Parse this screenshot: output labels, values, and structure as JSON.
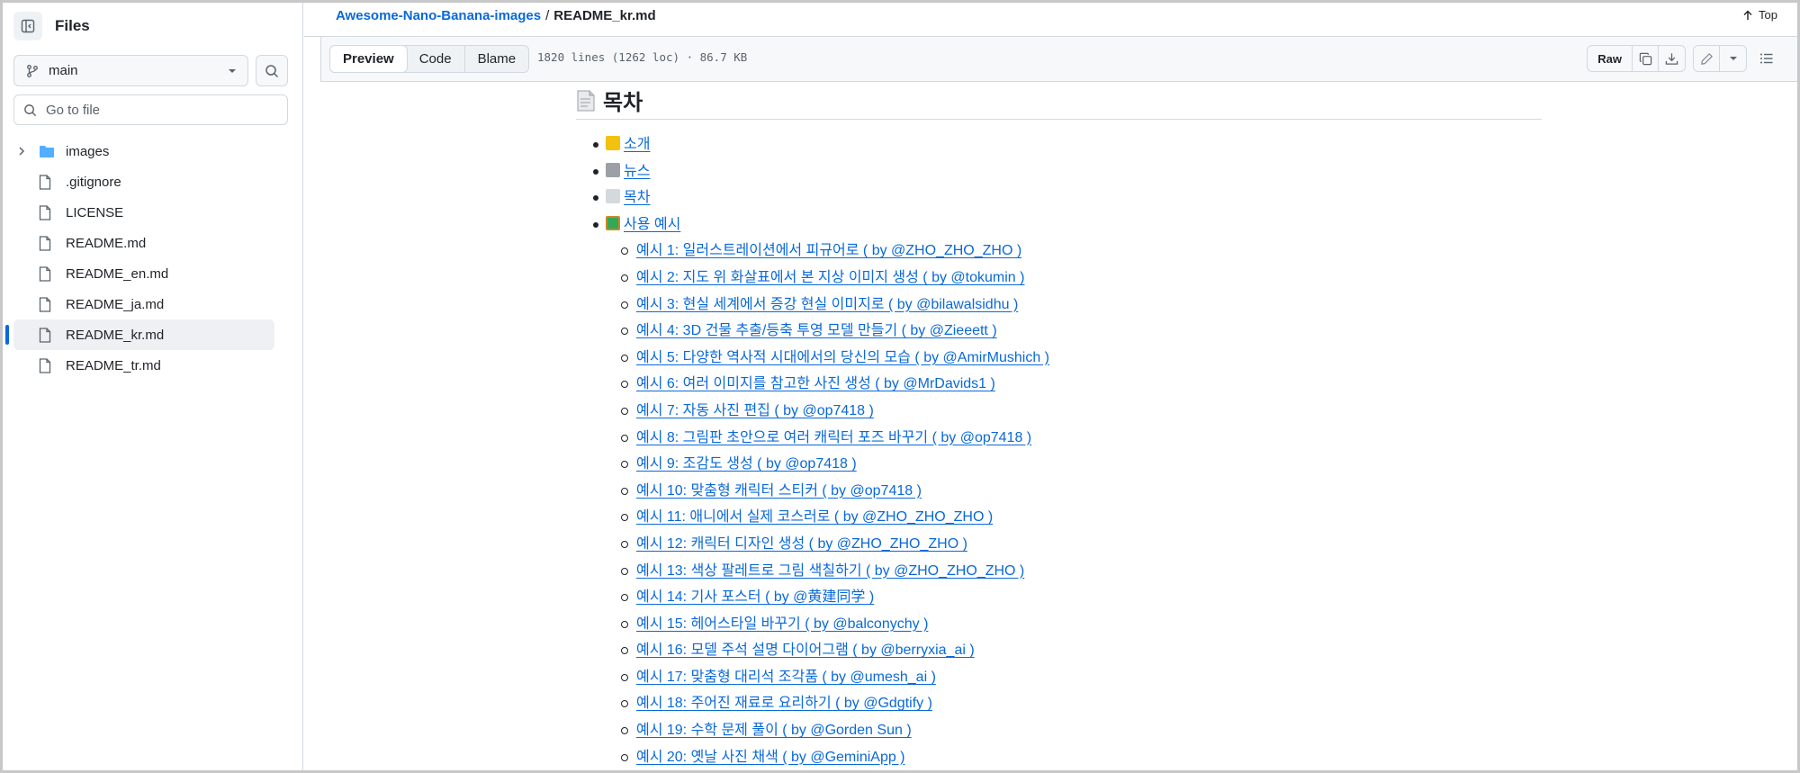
{
  "sidebar": {
    "title": "Files",
    "branch": "main",
    "goto_placeholder": "Go to file",
    "items": [
      {
        "name": "images",
        "type": "folder"
      },
      {
        "name": ".gitignore",
        "type": "file"
      },
      {
        "name": "LICENSE",
        "type": "file"
      },
      {
        "name": "README.md",
        "type": "file"
      },
      {
        "name": "README_en.md",
        "type": "file"
      },
      {
        "name": "README_ja.md",
        "type": "file"
      },
      {
        "name": "README_kr.md",
        "type": "file",
        "active": true
      },
      {
        "name": "README_tr.md",
        "type": "file"
      }
    ]
  },
  "breadcrumb": {
    "repo": "Awesome-Nano-Banana-images",
    "separator": "/",
    "file": "README_kr.md",
    "top_label": "Top"
  },
  "toolbar": {
    "tabs": [
      "Preview",
      "Code",
      "Blame"
    ],
    "active_tab": "Preview",
    "meta": "1820 lines (1262 loc) · 86.7 KB",
    "raw_label": "Raw"
  },
  "article": {
    "heading": "목차",
    "top_items": [
      {
        "label": "소개",
        "emoji_color": "#f4b400"
      },
      {
        "label": "뉴스",
        "emoji_color": "#9aa0a6"
      },
      {
        "label": "목차",
        "emoji_color": "#c0c4c8"
      },
      {
        "label": "사용 예시",
        "emoji_color": "#34a853"
      }
    ],
    "examples": [
      "예시 1: 일러스트레이션에서 피규어로 ( by @ZHO_ZHO_ZHO )",
      "예시 2: 지도 위 화살표에서 본 지상 이미지 생성 ( by @tokumin )",
      "예시 3: 현실 세계에서 증강 현실 이미지로 ( by @bilawalsidhu )",
      "예시 4: 3D 건물 추출/등축 투영 모델 만들기 ( by @Zieeett )",
      "예시 5: 다양한 역사적 시대에서의 당신의 모습 ( by @AmirMushich )",
      "예시 6: 여러 이미지를 참고한 사진 생성 ( by @MrDavids1 )",
      "예시 7: 자동 사진 편집 ( by @op7418 )",
      "예시 8: 그림판 초안으로 여러 캐릭터 포즈 바꾸기 ( by @op7418 )",
      "예시 9: 조감도 생성 ( by @op7418 )",
      "예시 10: 맞춤형 캐릭터 스티커 ( by @op7418 )",
      "예시 11: 애니에서 실제 코스러로 ( by @ZHO_ZHO_ZHO )",
      "예시 12: 캐릭터 디자인 생성 ( by @ZHO_ZHO_ZHO )",
      "예시 13: 색상 팔레트로 그림 색칠하기 ( by @ZHO_ZHO_ZHO )",
      "예시 14: 기사 포스터 ( by @黄建同学 )",
      "예시 15: 헤어스타일 바꾸기 ( by @balconychy )",
      "예시 16: 모델 주석 설명 다이어그램 ( by @berryxia_ai )",
      "예시 17: 맞춤형 대리석 조각품 ( by @umesh_ai )",
      "예시 18: 주어진 재료로 요리하기 ( by @Gdgtify )",
      "예시 19: 수학 문제 풀이 ( by @Gorden Sun )",
      "예시 20: 옛날 사진 채색 ( by @GeminiApp )"
    ]
  },
  "colors": {
    "link": "#0969da",
    "accent": "#0969da",
    "folder": "#54aeff"
  }
}
